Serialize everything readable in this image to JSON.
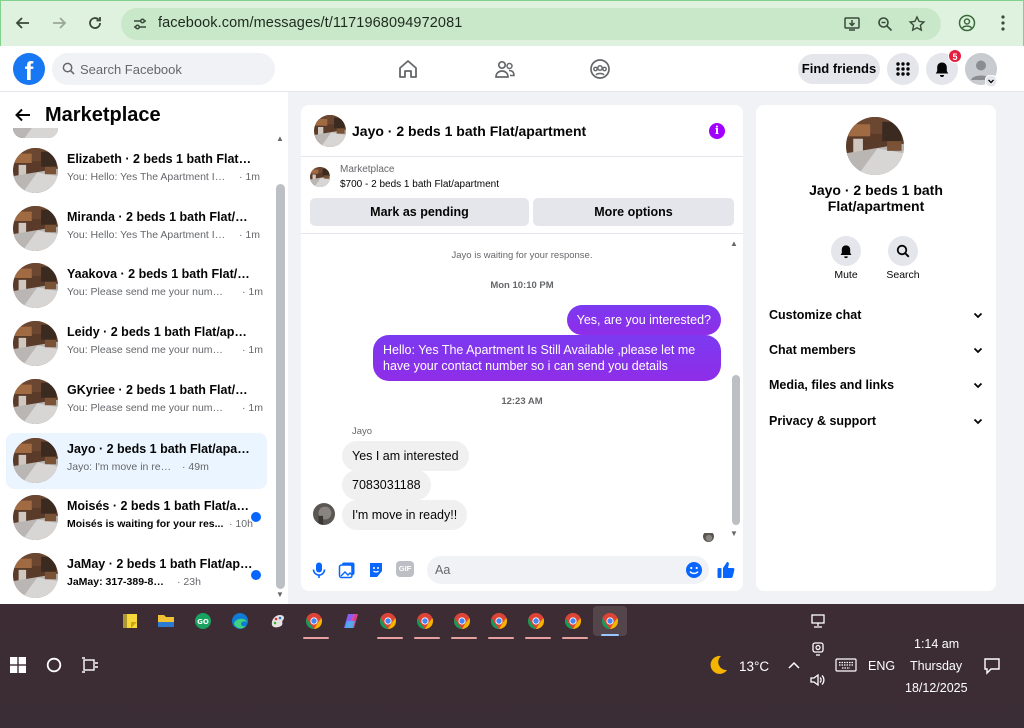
{
  "browser": {
    "url": "facebook.com/messages/t/1171968094972081"
  },
  "fb": {
    "search_placeholder": "Search Facebook",
    "find_friends": "Find friends",
    "notif_count": "5"
  },
  "left": {
    "title": "Marketplace",
    "conversations": [
      {
        "name": "Elizabeth · 2 beds 1 bath Flat/ap...",
        "preview": "You: Hello: Yes The Apartment Is S...",
        "time": "· 1m"
      },
      {
        "name": "Miranda · 2 beds 1 bath Flat/ap...",
        "preview": "You: Hello: Yes The Apartment Is S...",
        "time": "· 1m"
      },
      {
        "name": "Yaakova · 2 beds 1 bath Flat/apa...",
        "preview": "You: Please send me your number...",
        "time": "· 1m"
      },
      {
        "name": "Leidy · 2 beds 1 bath Flat/apart...",
        "preview": "You: Please send me your number...",
        "time": "· 1m"
      },
      {
        "name": "GKyriee · 2 beds 1 bath Flat/apa...",
        "preview": "You: Please send me your number...",
        "time": "· 1m"
      },
      {
        "name": "Jayo · 2 beds 1 bath Flat/apartm...",
        "preview": "Jayo: I'm move in ready!!",
        "time": "· 49m"
      },
      {
        "name": "Moisés · 2 beds 1 bath Flat/ap...",
        "preview": "Moisés is waiting for your res...",
        "time": "· 10h"
      },
      {
        "name": "JaMay · 2 beds 1 bath Flat/apa...",
        "preview": "JaMay: 317-389-8790",
        "time": "· 23h"
      }
    ]
  },
  "chat": {
    "title": "Jayo · 2 beds 1 bath Flat/apartment",
    "info_glyph": "i",
    "marketplace_label": "Marketplace",
    "listing": "$700 - 2 beds 1 bath Flat/apartment",
    "mark_pending": "Mark as pending",
    "more_options": "More options",
    "waiting_note": "Jayo is waiting for your response.",
    "stamp1": "Mon 10:10 PM",
    "out1": "Yes, are you interested?",
    "out2": "Hello: Yes The Apartment Is Still Available ,please let me have your contact number so i can send you details",
    "stamp2": "12:23 AM",
    "sender": "Jayo",
    "in1": "Yes I am interested",
    "in2": "7083031188",
    "in3": "I'm move in ready!!",
    "composer_placeholder": "Aa",
    "gif_label": "GIF"
  },
  "info": {
    "name": "Jayo · 2 beds 1 bath Flat/apartment",
    "mute": "Mute",
    "search": "Search",
    "sections": [
      "Customize chat",
      "Chat members",
      "Media, files and links",
      "Privacy & support"
    ]
  },
  "taskbar": {
    "temp": "13°C",
    "lang": "ENG",
    "time": "1:14 am",
    "day": "Thursday",
    "date": "18/12/2025"
  },
  "colors": {
    "fb_blue": "#1877f2",
    "messenger_purple": "#8a2be2",
    "unread_dot": "#0866ff",
    "chrome_green": "#dff2df",
    "taskbar": "#3c2d33"
  }
}
